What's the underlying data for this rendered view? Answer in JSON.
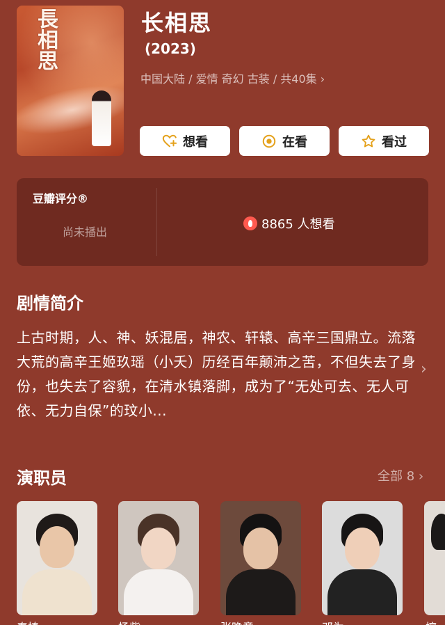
{
  "poster": {
    "calligraphy": "長相思"
  },
  "show": {
    "title": "长相思",
    "year": "(2023)",
    "meta": "中国大陆 / 爱情 奇幻 古装 / 共40集"
  },
  "actions": {
    "want_label": "想看",
    "watching_label": "在看",
    "watched_label": "看过"
  },
  "rating": {
    "label": "豆瓣评分®",
    "status": "尚未播出",
    "want_count": "8865 人想看"
  },
  "synopsis": {
    "title": "剧情简介",
    "text": "上古时期，人、神、妖混居，神农、轩辕、高辛三国鼎立。流落大荒的高辛王姬玖瑶（小夭）历经百年颠沛之苦，不但失去了身份，也失去了容貌，在清水镇落脚，成为了“无处可去、无人可依、无力自保”的玟小..."
  },
  "cast": {
    "title": "演职员",
    "all_label": "全部 8",
    "members": [
      {
        "name": "秦榛"
      },
      {
        "name": "杨紫"
      },
      {
        "name": "张晚意"
      },
      {
        "name": "邓为"
      },
      {
        "name": "檀"
      }
    ]
  },
  "colors": {
    "background": "#8f3a2c",
    "card": "#6f2a20",
    "accent": "#e4a11b",
    "flame": "#ff5a4f"
  },
  "icons": {
    "want": "heart-plus-icon",
    "watching": "target-circle-icon",
    "watched": "star-icon",
    "more": "chevron-right-icon"
  }
}
